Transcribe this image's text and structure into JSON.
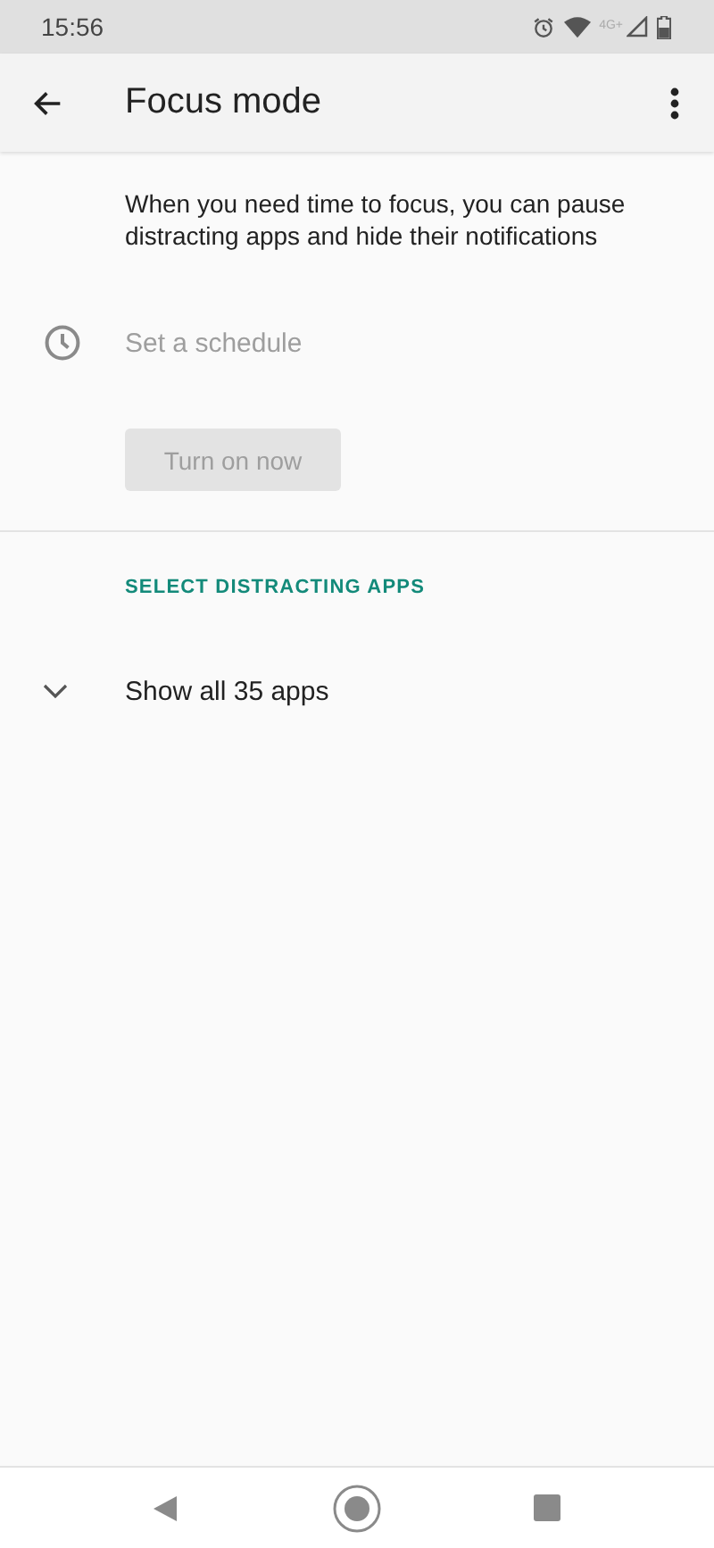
{
  "status_bar": {
    "time": "15:56",
    "network_label": "4G+"
  },
  "app_bar": {
    "title": "Focus mode"
  },
  "description": "When you need time to focus, you can pause distracting apps and hide their notifications",
  "schedule": {
    "label": "Set a schedule",
    "disabled": true
  },
  "turn_on_button": {
    "label": "Turn on now",
    "disabled": true
  },
  "section_header": "SELECT DISTRACTING APPS",
  "show_all": {
    "label": "Show all 35 apps",
    "expanded": false
  }
}
